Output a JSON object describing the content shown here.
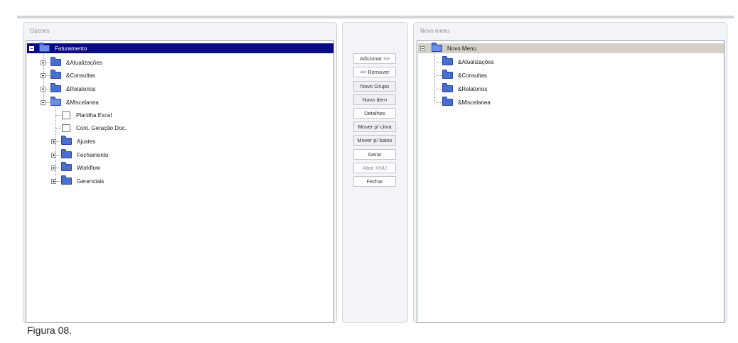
{
  "left_panel": {
    "title": "Opcoes",
    "nodes": [
      {
        "label": "Faturamento"
      },
      {
        "label": "&Atualizações"
      },
      {
        "label": "&Consultas"
      },
      {
        "label": "&Relatorios"
      },
      {
        "label": "&Miscelanea"
      },
      {
        "label": "Planilha Excel"
      },
      {
        "label": "Cont. Geração Doc."
      },
      {
        "label": "Ajustes"
      },
      {
        "label": "Fechamento"
      },
      {
        "label": "Workflow"
      },
      {
        "label": "Gerenciais"
      }
    ]
  },
  "middle_panel": {
    "buttons": [
      {
        "label": "Adicionar >>"
      },
      {
        "label": "<< Remover"
      },
      {
        "label": "Novo Grupo"
      },
      {
        "label": "Novo Item"
      },
      {
        "label": "Detalhes"
      },
      {
        "label": "Mover p/ cima"
      },
      {
        "label": "Mover p/ baixo"
      },
      {
        "label": "Gerar"
      },
      {
        "label": "Abrir XNU"
      },
      {
        "label": "Fechar"
      }
    ]
  },
  "right_panel": {
    "title": "Novo menu",
    "nodes": [
      {
        "label": "Novo Menu"
      },
      {
        "label": "&Atualizações"
      },
      {
        "label": "&Consultas"
      },
      {
        "label": "&Relatorios"
      },
      {
        "label": "&Miscelanea"
      }
    ]
  },
  "caption": "Figura 08.",
  "colors": {
    "selection": "#0a0a84",
    "folder": "#4a6fd1",
    "panel": "#f2f4f8"
  },
  "icons": {
    "folder": "folder-icon",
    "folder_open": "folder-open-icon",
    "file": "file-icon",
    "expand": "expand-plus-icon",
    "collapse": "collapse-minus-icon"
  }
}
